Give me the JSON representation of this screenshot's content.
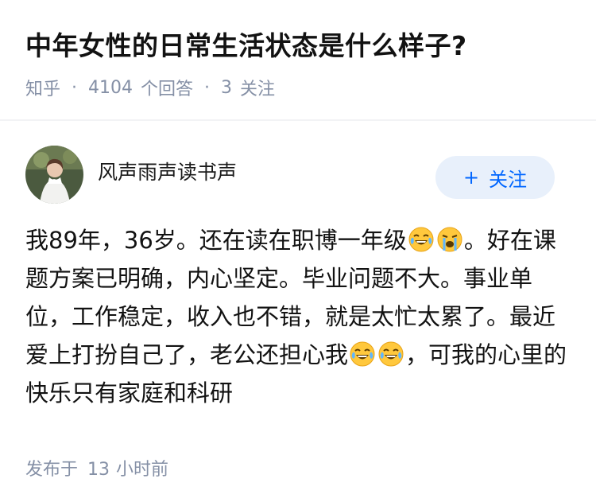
{
  "question": {
    "title": "中年女性的日常生活状态是什么样子?",
    "source": "知乎",
    "answer_count": "4104",
    "answer_label": "个回答",
    "follow_count": "3",
    "follow_label": "关注"
  },
  "author": {
    "name": "风声雨声读书声",
    "follow_button": "关注",
    "follow_icon": "plus-icon"
  },
  "answer": {
    "part1": "我89年，36岁。还在读在职博一年级",
    "part2": "。好在课题方案已明确，内心坚定。毕业问题不大。事业单位，工作稳定，收入也不错，就是太忙太累了。最近爱上打扮自己了，老公还担心我",
    "part3": "，可我的心里的快乐只有家庭和科研",
    "emojis": [
      "laugh-cry-emoji",
      "sob-emoji",
      "laugh-cry-emoji",
      "laugh-cry-emoji"
    ]
  },
  "footer": {
    "published_prefix": "发布于",
    "published_num": "13",
    "published_suffix": "小时前"
  },
  "colors": {
    "meta": "#8590a6",
    "follow_bg": "#e8f0fb",
    "follow_text": "#0066ff",
    "emoji_face": "#ffc83d"
  }
}
